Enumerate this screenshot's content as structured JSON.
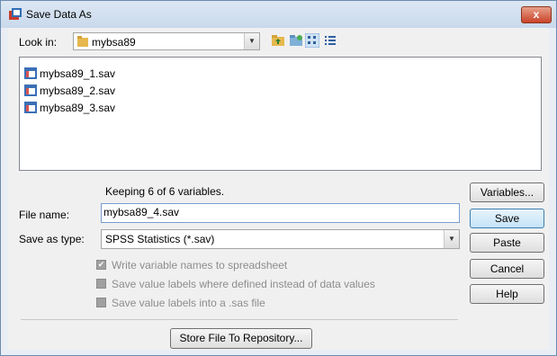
{
  "window": {
    "title": "Save Data As",
    "close_label": "x"
  },
  "look_in": {
    "label": "Look in:",
    "folder": "mybsa89"
  },
  "files": [
    {
      "name": "mybsa89_1.sav"
    },
    {
      "name": "mybsa89_2.sav"
    },
    {
      "name": "mybsa89_3.sav"
    }
  ],
  "keeping_text": "Keeping 6 of 6 variables.",
  "file_name": {
    "label": "File name:",
    "value": "mybsa89_4.sav"
  },
  "save_as_type": {
    "label": "Save as type:",
    "value": "SPSS Statistics (*.sav)"
  },
  "options": {
    "write_names": "Write variable names to spreadsheet",
    "save_labels": "Save value labels where defined instead of data values",
    "save_sas": "Save value labels into a .sas file"
  },
  "buttons": {
    "variables": "Variables...",
    "save": "Save",
    "paste": "Paste",
    "cancel": "Cancel",
    "help": "Help",
    "store": "Store File To Repository..."
  },
  "colors": {
    "accent": "#3c7fb1",
    "close": "#c9432a"
  }
}
